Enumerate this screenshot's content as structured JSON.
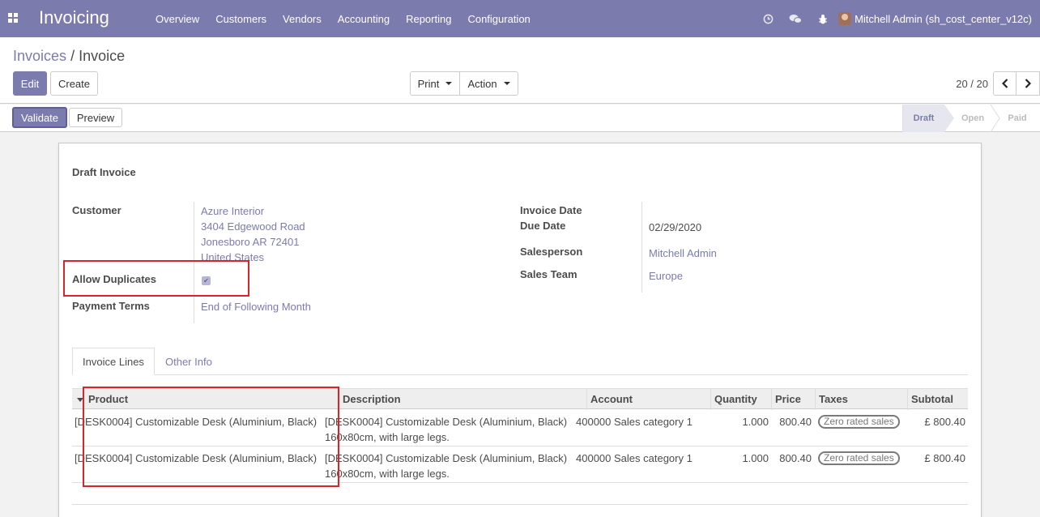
{
  "navbar": {
    "app_title": "Invoicing",
    "menu": [
      "Overview",
      "Customers",
      "Vendors",
      "Accounting",
      "Reporting",
      "Configuration"
    ],
    "icons": [
      "clock-icon",
      "chat-icon",
      "bug-icon"
    ],
    "user": "Mitchell Admin (sh_cost_center_v12c)"
  },
  "breadcrumb": {
    "parent": "Invoices",
    "separator": "/",
    "current": "Invoice"
  },
  "toolbar": {
    "edit_label": "Edit",
    "create_label": "Create",
    "print_label": "Print",
    "action_label": "Action",
    "pager_value": "20 / 20"
  },
  "statusbar": {
    "validate_label": "Validate",
    "preview_label": "Preview",
    "steps": [
      "Draft",
      "Open",
      "Paid"
    ],
    "active_step": "Draft"
  },
  "form": {
    "title": "Draft Invoice",
    "customer_label": "Customer",
    "customer_lines": [
      "Azure Interior",
      "3404 Edgewood Road",
      "Jonesboro AR 72401",
      "United States"
    ],
    "allow_duplicates_label": "Allow Duplicates",
    "allow_duplicates_checked": true,
    "payment_terms_label": "Payment Terms",
    "payment_terms_value": "End of Following Month",
    "invoice_date_label": "Invoice Date",
    "invoice_date_value": "",
    "due_date_label": "Due Date",
    "due_date_value": "02/29/2020",
    "salesperson_label": "Salesperson",
    "salesperson_value": "Mitchell Admin",
    "sales_team_label": "Sales Team",
    "sales_team_value": "Europe"
  },
  "tabs": {
    "lines": "Invoice Lines",
    "other": "Other Info"
  },
  "table": {
    "columns": [
      "Product",
      "Description",
      "Account",
      "Quantity",
      "Price",
      "Taxes",
      "Subtotal"
    ],
    "rows": [
      {
        "product": "[DESK0004] Customizable Desk (Aluminium, Black)",
        "description_1": "[DESK0004] Customizable Desk (Aluminium, Black)",
        "description_2": "160x80cm, with large legs.",
        "account": "400000 Sales category 1",
        "quantity": "1.000",
        "price": "800.40",
        "tax": "Zero rated sales",
        "subtotal": "£ 800.40"
      },
      {
        "product": "[DESK0004] Customizable Desk (Aluminium, Black)",
        "description_1": "[DESK0004] Customizable Desk (Aluminium, Black)",
        "description_2": "160x80cm, with large legs.",
        "account": "400000 Sales category 1",
        "quantity": "1.000",
        "price": "800.40",
        "tax": "Zero rated sales",
        "subtotal": "£ 800.40"
      }
    ]
  },
  "colors": {
    "brand": "#7c7bad",
    "highlight": "#d9242b"
  }
}
